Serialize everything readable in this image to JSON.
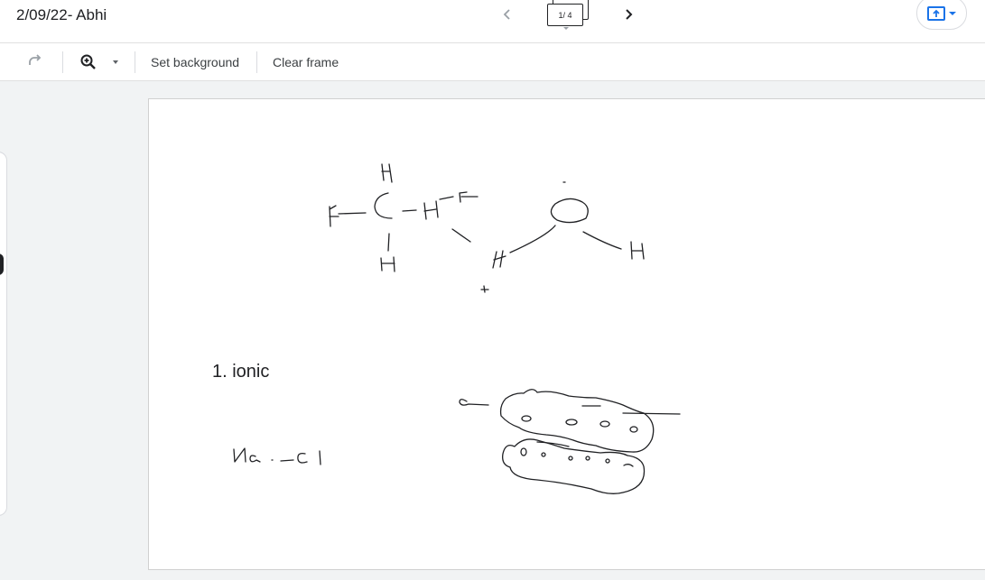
{
  "header": {
    "title": "2/09/22- Abhi",
    "frame_counter": "1/ 4"
  },
  "toolbar": {
    "set_background": "Set background",
    "clear_frame": "Clear frame"
  },
  "canvas": {
    "text_box": "1. ionic",
    "handwriting_salt": "Na•—Cl"
  },
  "colors": {
    "accent": "#1a73e8",
    "ink": "#202124"
  }
}
